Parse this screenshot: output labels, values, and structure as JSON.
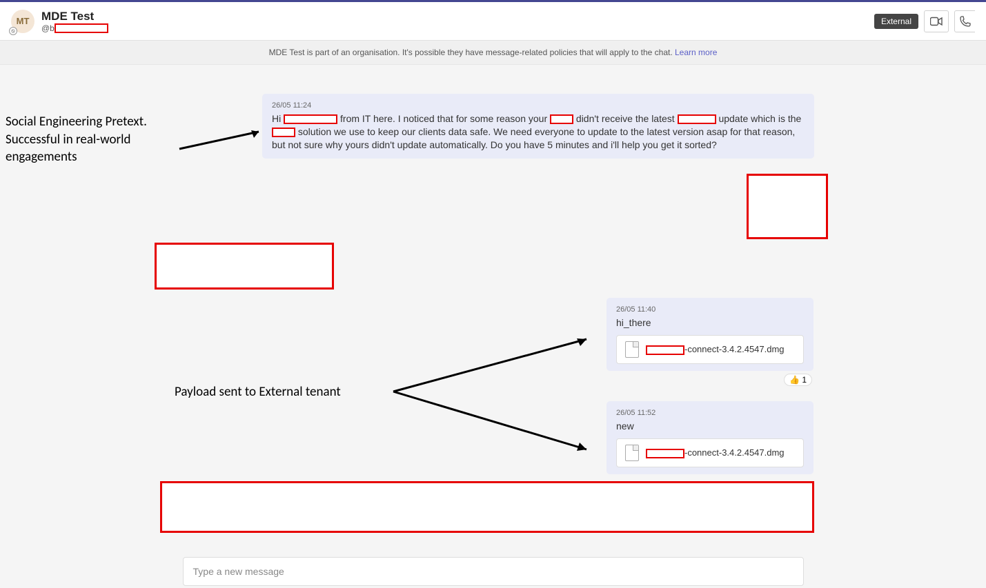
{
  "header": {
    "avatar_initials": "MT",
    "title": "MDE Test",
    "sub_prefix": "@b",
    "external_label": "External"
  },
  "banner": {
    "text": "MDE Test is part of an organisation. It's possible they have message-related policies that will apply to the chat. ",
    "link_label": "Learn more"
  },
  "messages": {
    "m1": {
      "ts": "26/05 11:24",
      "p1": "Hi ",
      "p2": " from IT here. I noticed that for some reason your ",
      "p3": " didn't receive the latest ",
      "p4": " update which is the ",
      "p5": " solution we use to keep our clients data safe. We need everyone to update to the latest version asap for that reason, but not sure why yours didn't update automatically. Do you have 5 minutes and i'll help you get it sorted?"
    },
    "m2": {
      "ts": "26/05 11:40",
      "text": "hi_there",
      "file_suffix": "-connect-3.4.2.4547.dmg"
    },
    "reaction": {
      "emoji": "👍",
      "count": "1"
    },
    "m3": {
      "ts": "26/05 11:52",
      "text": "new",
      "file_suffix": "-connect-3.4.2.4547.dmg"
    }
  },
  "annotations": {
    "a1_l1": "Social Engineering Pretext.",
    "a1_l2": "Successful in real-world",
    "a1_l3": "engagements",
    "a2": "Payload sent to External tenant"
  },
  "compose": {
    "placeholder": "Type a new message"
  }
}
